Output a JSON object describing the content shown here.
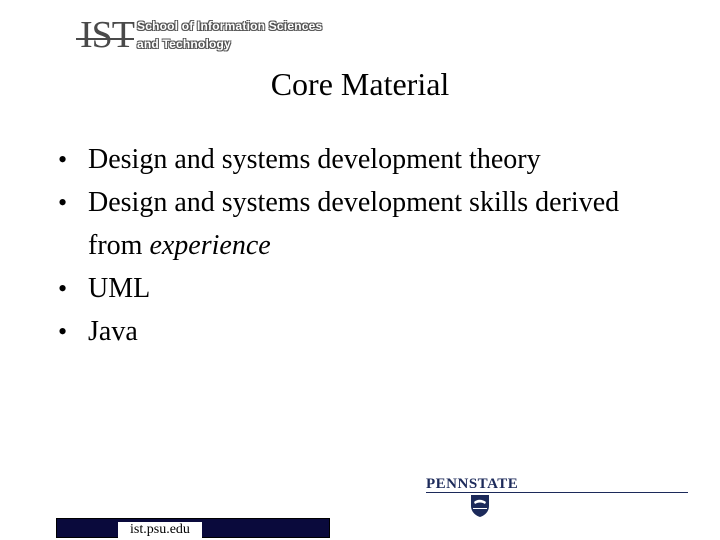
{
  "header": {
    "logo_mark": "IST",
    "org_line1": "School of Information Sciences",
    "org_line2": "and Technology"
  },
  "slide": {
    "title": "Core Material",
    "bullets": [
      {
        "text": "Design and systems development theory"
      },
      {
        "text": "Design and systems development skills derived from",
        "emphasis": "experience"
      },
      {
        "text": "UML"
      },
      {
        "text": "Java"
      }
    ]
  },
  "footer": {
    "url": "ist.psu.edu",
    "brand": "PENNSTATE",
    "brand_color": "#1c2a5a",
    "bar_color": "#0a0a3c"
  }
}
